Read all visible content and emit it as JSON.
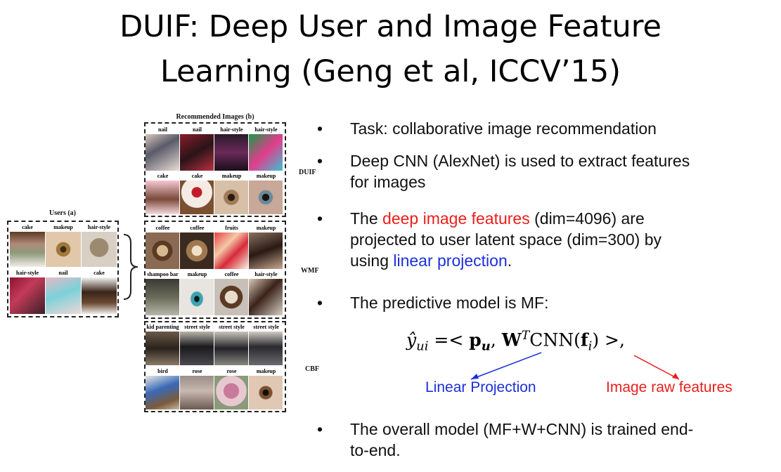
{
  "title": {
    "line1": "DUIF: Deep User and Image Feature",
    "line2": "Learning (Geng et al, ICCV’15)"
  },
  "figure": {
    "users_label": "Users (a)",
    "recommended_label": "Recommended Images (b)",
    "users_captions": [
      "cake",
      "makeup",
      "hair-style",
      "hair-style",
      "nail",
      "cake"
    ],
    "groups": [
      {
        "label": "DUIF",
        "captions": [
          "nail",
          "nail",
          "hair-style",
          "hair-style",
          "cake",
          "cake",
          "makeup",
          "makeup"
        ]
      },
      {
        "label": "WMF",
        "captions": [
          "coffee",
          "coffee",
          "fruits",
          "makeup",
          "shampoo bar",
          "makeup",
          "coffee",
          "hair-style"
        ]
      },
      {
        "label": "CBF",
        "captions": [
          "kid parenting",
          "street style",
          "street style",
          "street style",
          "bird",
          "rose",
          "rose",
          "makeup"
        ]
      }
    ]
  },
  "bullets": [
    {
      "text": "Task: collaborative image recommendation"
    },
    {
      "line1": "Deep CNN (AlexNet) is used to extract features",
      "line2": "for images"
    },
    {
      "pre": "The ",
      "red": "deep image features",
      "post": " (dim=4096) are",
      "line2": "projected to user latent space (dim=300) by",
      "line3_pre": "using ",
      "blue": "linear projection",
      "line3_post": "."
    },
    {
      "text": "The predictive model is MF:"
    },
    {
      "line1": "The overall model (MF+W+CNN) is trained end-",
      "line2": "to-end."
    }
  ],
  "formula_labels": {
    "linear_projection": "Linear Projection",
    "image_raw_features": "Image raw features"
  },
  "colors": {
    "red": "#e8201c",
    "blue": "#1c2fd8"
  }
}
